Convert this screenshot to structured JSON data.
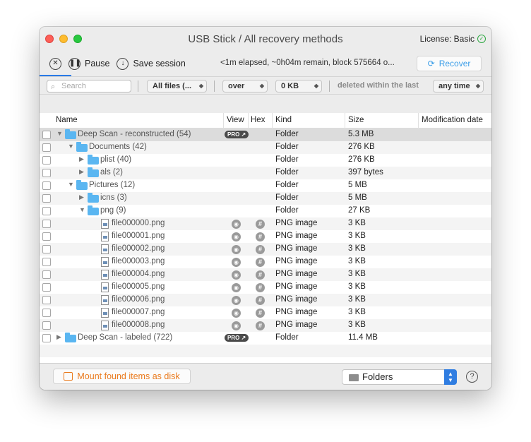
{
  "window": {
    "title": "USB Stick / All recovery methods",
    "license_label": "License: Basic"
  },
  "toolbar": {
    "pause_label": "Pause",
    "save_session_label": "Save session",
    "status": "<1m elapsed, ~0h04m remain, block 575664 o...",
    "recover_label": "Recover"
  },
  "filter": {
    "search_placeholder": "Search",
    "files_select": "All files (...",
    "size_op": "over",
    "size_value": "0 KB",
    "deleted_label": "deleted within the last",
    "time_select": "any time"
  },
  "columns": {
    "name": "Name",
    "view": "View",
    "hex": "Hex",
    "kind": "Kind",
    "size": "Size",
    "date": "Modification date"
  },
  "pro_badge": "PRO ↗",
  "rows": [
    {
      "name": "Deep Scan - reconstructed (54)",
      "kind": "Folder",
      "size": "5.3 MB"
    },
    {
      "name": "Documents (42)",
      "kind": "Folder",
      "size": "276 KB"
    },
    {
      "name": "plist (40)",
      "kind": "Folder",
      "size": "276 KB"
    },
    {
      "name": "als (2)",
      "kind": "Folder",
      "size": "397 bytes"
    },
    {
      "name": "Pictures (12)",
      "kind": "Folder",
      "size": "5 MB"
    },
    {
      "name": "icns (3)",
      "kind": "Folder",
      "size": "5 MB"
    },
    {
      "name": "png (9)",
      "kind": "Folder",
      "size": "27 KB"
    },
    {
      "name": "file000000.png",
      "kind": "PNG image",
      "size": "3 KB"
    },
    {
      "name": "file000001.png",
      "kind": "PNG image",
      "size": "3 KB"
    },
    {
      "name": "file000002.png",
      "kind": "PNG image",
      "size": "3 KB"
    },
    {
      "name": "file000003.png",
      "kind": "PNG image",
      "size": "3 KB"
    },
    {
      "name": "file000004.png",
      "kind": "PNG image",
      "size": "3 KB"
    },
    {
      "name": "file000005.png",
      "kind": "PNG image",
      "size": "3 KB"
    },
    {
      "name": "file000006.png",
      "kind": "PNG image",
      "size": "3 KB"
    },
    {
      "name": "file000007.png",
      "kind": "PNG image",
      "size": "3 KB"
    },
    {
      "name": "file000008.png",
      "kind": "PNG image",
      "size": "3 KB"
    },
    {
      "name": "Deep Scan - labeled (722)",
      "kind": "Folder",
      "size": "11.4 MB"
    }
  ],
  "bottom": {
    "mount_label": "Mount found items as disk",
    "view_select": "Folders",
    "help": "?"
  },
  "icons": [
    "close-icon",
    "pause-icon",
    "download-icon",
    "recover-icon",
    "search-icon",
    "folder-icon",
    "file-icon",
    "eye-icon",
    "hash-icon",
    "disk-icon",
    "help-icon"
  ],
  "colors": {
    "accent": "#2f7de1",
    "recover": "#3a9de8",
    "mount": "#ea7b1f",
    "folder": "#5ab6f1"
  }
}
